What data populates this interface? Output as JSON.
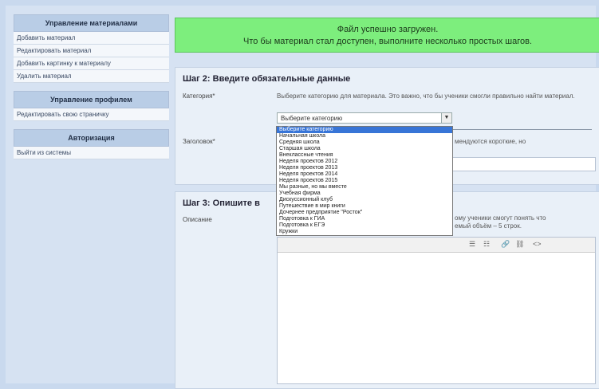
{
  "sidebar": {
    "sections": [
      {
        "title": "Управление материалами",
        "items": [
          "Добавить материал",
          "Редактировать материал",
          "Добавить картинку к материалу",
          "Удалить материал"
        ]
      },
      {
        "title": "Управление профилем",
        "items": [
          "Редактировать свою страничку"
        ]
      },
      {
        "title": "Авторизация",
        "items": [
          "Выйти из системы"
        ]
      }
    ]
  },
  "banner": {
    "line1": "Файл успешно загружен.",
    "line2": "Что бы материал стал доступен, выполните несколько простых шагов."
  },
  "step2": {
    "title": "Шаг 2: Введите обязательные данные",
    "category_label": "Категория*",
    "category_help": "Выберите категорию для материала. Это важно, что бы ученики смогли правильно найти материал.",
    "category_selected": "Выберите категорию",
    "title_label": "Заголовок*",
    "title_help_visible": "мендуются короткие, но"
  },
  "dropdown": {
    "options": [
      "Выберите категорию",
      "Начальная школа",
      "Средняя школа",
      "Старшая школа",
      "Внеклассные чтения",
      "Неделя проектов 2012",
      "Неделя проектов 2013",
      "Неделя проектов 2014",
      "Неделя проектов 2015",
      "Мы разные, но мы вместе",
      "Учебная фирма",
      "Дискуссионный клуб",
      "Путешествие в мир книги",
      "Дочернее предприятие \"Росток\"",
      "Подготовка к ГИА",
      "Подготовка к ЕГЭ",
      "Кружки"
    ]
  },
  "step3": {
    "title_visible": "Шаг 3: Опишите в",
    "desc_label": "Описание",
    "desc_help_visible": "ому ученики смогут понять что\nемый объём – 5 строк."
  },
  "toolbar": {
    "icons": [
      "list-ul-icon",
      "list-ol-icon",
      "link-icon",
      "unlink-icon",
      "code-icon"
    ],
    "glyphs": [
      "☰",
      "☷",
      "🔗",
      "⛓",
      "<>"
    ]
  }
}
